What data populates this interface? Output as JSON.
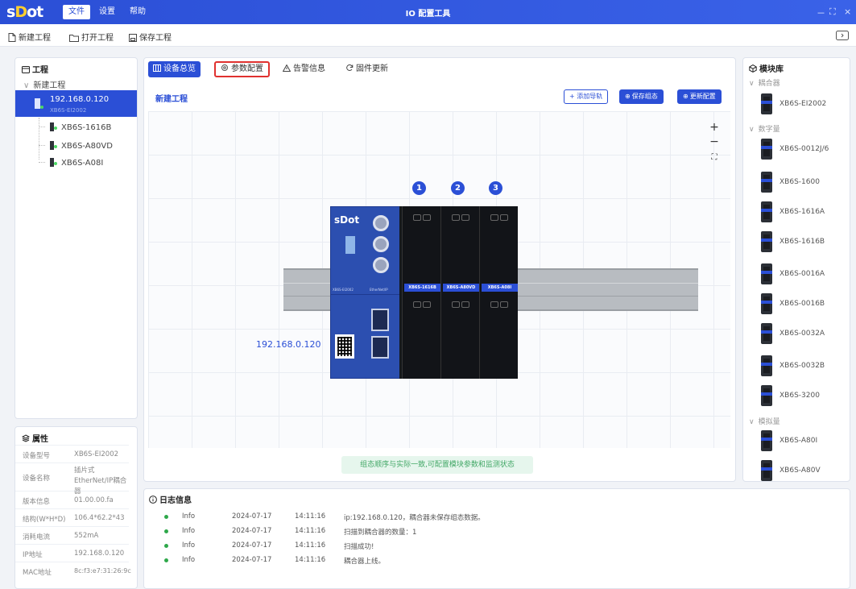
{
  "titlebar": {
    "logo_text_left": "s",
    "logo_text_mid": "D",
    "logo_text_right": "ot",
    "menus": [
      "文件",
      "设置",
      "帮助"
    ],
    "app_title": "IO 配置工具",
    "win_min": "－",
    "win_max": "⛶",
    "win_close": "×"
  },
  "toolbar": {
    "new_project": "新建工程",
    "open_project": "打开工程",
    "save_project": "保存工程"
  },
  "project_panel": {
    "title": "工程",
    "root": "新建工程",
    "device": {
      "ip": "192.168.0.120",
      "model": "XB6S-EI2002"
    },
    "modules": [
      "XB6S-1616B",
      "XB6S-A80VD",
      "XB6S-A08I"
    ]
  },
  "properties": {
    "title": "属性",
    "rows": [
      {
        "key": "设备型号",
        "value": "XB6S-EI2002"
      },
      {
        "key": "设备名称",
        "value": "插片式EtherNet/IP耦合器"
      },
      {
        "key": "版本信息",
        "value": "01.00.00.fa"
      },
      {
        "key": "结构(W*H*D)",
        "value": "106.4*62.2*43"
      },
      {
        "key": "消耗电流",
        "value": "552mA"
      },
      {
        "key": "IP地址",
        "value": "192.168.0.120"
      },
      {
        "key": "MAC地址",
        "value": "8c:f3:e7:31:26:9c"
      }
    ]
  },
  "tabs": [
    "设备总览",
    "参数配置",
    "告警信息",
    "固件更新"
  ],
  "workspace": {
    "project_name": "新建工程",
    "buttons": {
      "add_rail": "+ 添加导轨",
      "save_config": "保存组态",
      "update_config": "更新配置"
    },
    "zoom_in": "+",
    "zoom_out": "−",
    "fit": "⛶",
    "slot_numbers": [
      "1",
      "2",
      "3"
    ],
    "coupler_ip": "192.168.0.120",
    "coupler_brand": "sDot",
    "coupler_model_small": "XB6S-EI2002",
    "coupler_protocol_small": "EtherNet/IP",
    "module_labels": [
      "XB6S-1616B",
      "XB6S-A80VD",
      "XB6S-A08I"
    ],
    "hint": "组态顺序与实际一致,可配置模块参数和监测状态"
  },
  "library": {
    "title": "模块库",
    "groups": [
      {
        "name": "耦合器",
        "items": [
          "XB6S-EI2002"
        ]
      },
      {
        "name": "数字量",
        "items": [
          "XB6S-0012J/6",
          "XB6S-1600",
          "XB6S-1616A",
          "XB6S-1616B",
          "XB6S-0016A",
          "XB6S-0016B",
          "XB6S-0032A",
          "XB6S-0032B",
          "XB6S-3200"
        ]
      },
      {
        "name": "模拟量",
        "items": [
          "XB6S-A80I",
          "XB6S-A80V"
        ]
      }
    ]
  },
  "log": {
    "title": "日志信息",
    "rows": [
      {
        "level": "Info",
        "date": "2024-07-17",
        "time": "14:11:16",
        "msg": "ip:192.168.0.120，耦合器未保存组态数据。"
      },
      {
        "level": "Info",
        "date": "2024-07-17",
        "time": "14:11:16",
        "msg": "扫描到耦合器的数量：1"
      },
      {
        "level": "Info",
        "date": "2024-07-17",
        "time": "14:11:16",
        "msg": "扫描成功!"
      },
      {
        "level": "Info",
        "date": "2024-07-17",
        "time": "14:11:16",
        "msg": "耦合器上线。"
      }
    ]
  },
  "colors": {
    "primary": "#2b4fd6",
    "titlebar": "#3a62e8",
    "highlight_border": "#e0312f",
    "info_dot": "#2ea84a",
    "hint_bg": "#e6f6ed"
  }
}
